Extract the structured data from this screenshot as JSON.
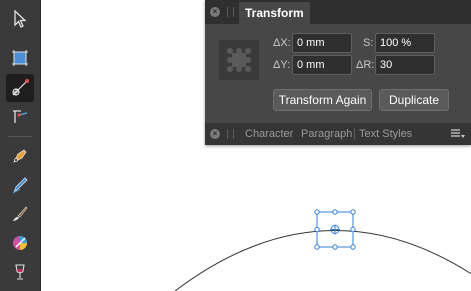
{
  "panel": {
    "title": "Transform",
    "fields": {
      "x_label": "ΔX:",
      "x_value": "0 mm",
      "y_label": "ΔY:",
      "y_value": "0 mm",
      "s_label": "S:",
      "s_value": "100 %",
      "r_label": "ΔR:",
      "r_value": "30"
    },
    "buttons": {
      "transform_again": "Transform Again",
      "duplicate": "Duplicate"
    },
    "bottom_tabs": [
      "Character",
      "Paragraph",
      "Text Styles"
    ]
  },
  "toolbar": {
    "tools": [
      "move-tool-icon",
      "artboard-tool-icon",
      "node-tool-icon",
      "point-transform-tool-icon",
      "pen-tool-icon",
      "pencil-tool-icon",
      "vector-brush-tool-icon",
      "fill-tool-icon",
      "transparency-tool-icon"
    ],
    "active_tool": "node-tool-icon"
  },
  "colors": {
    "selection": "#2f7fd6",
    "panel_bg": "#474747",
    "toolbar_bg": "#3a3a3a"
  }
}
